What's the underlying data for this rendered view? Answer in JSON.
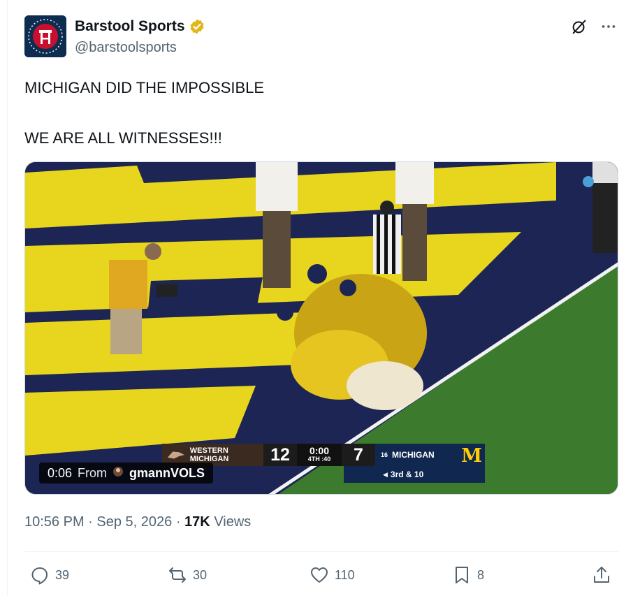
{
  "author": {
    "display_name": "Barstool Sports",
    "handle": "@barstoolsports",
    "avatar_icon": "barstool-logo",
    "verified_color": "#e2b719"
  },
  "tweet": {
    "line1": "MICHIGAN DID THE IMPOSSIBLE",
    "line2": "WE ARE ALL WITNESSES!!!"
  },
  "video": {
    "time": "0:06",
    "from_label": "From",
    "from_user": "gmannVOLS",
    "scorebug": {
      "away_team": "WESTERN MICHIGAN",
      "away_score": "12",
      "clock": "0:00",
      "quarter": "4TH :40",
      "home_score": "7",
      "home_rank": "16",
      "home_team": "MICHIGAN",
      "home_logo": "M",
      "down": "3rd & 10"
    }
  },
  "meta": {
    "time": "10:56 PM",
    "date": "Sep 5, 2026",
    "views_count": "17K",
    "views_label": "Views"
  },
  "actions": {
    "replies": "39",
    "reposts": "30",
    "likes": "110",
    "bookmarks": "8"
  },
  "colors": {
    "text_primary": "#0f1419",
    "text_secondary": "#536471",
    "michigan_maize": "#ffcb05",
    "michigan_blue": "#10284f"
  }
}
